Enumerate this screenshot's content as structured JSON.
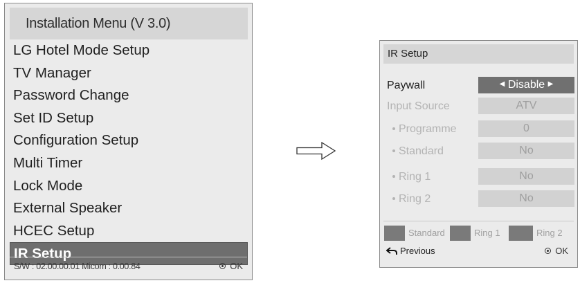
{
  "install_menu": {
    "title": "Installation Menu (V 3.0)",
    "items": [
      {
        "label": "LG Hotel Mode Setup"
      },
      {
        "label": "TV Manager"
      },
      {
        "label": "Password Change"
      },
      {
        "label": "Set ID Setup"
      },
      {
        "label": "Configuration Setup"
      },
      {
        "label": "Multi Timer"
      },
      {
        "label": "Lock Mode"
      },
      {
        "label": "External Speaker"
      },
      {
        "label": "HCEC Setup"
      },
      {
        "label": "IR Setup",
        "selected": true
      }
    ],
    "footer": {
      "version": "S/W : 02.00.00.01 Micom : 0.00.84",
      "ok_label": "OK"
    }
  },
  "ir_setup": {
    "title": "IR Setup",
    "rows": [
      {
        "label": "Paywall",
        "value": "Disable",
        "active": true
      },
      {
        "label": "Input Source",
        "value": "ATV"
      },
      {
        "label": "Programme",
        "value": "0"
      },
      {
        "label": "Standard",
        "value": "No"
      },
      {
        "label": "Ring 1",
        "value": "No"
      },
      {
        "label": "Ring 2",
        "value": "No"
      }
    ],
    "keys": [
      {
        "label": "Standard"
      },
      {
        "label": "Ring 1"
      },
      {
        "label": "Ring 2"
      }
    ],
    "previous_label": "Previous",
    "ok_label": "OK"
  },
  "colors": {
    "panel_bg": "#ebebeb",
    "selected_bg": "#6e6e6e",
    "active_value_bg": "#707070",
    "disabled_text": "#b3b3b3"
  },
  "icons": {
    "transition_arrow": "right-arrow-outline-icon",
    "ok": "ok-radio-icon",
    "previous": "back-arrow-icon",
    "value_left": "triangle-left-icon",
    "value_right": "triangle-right-icon"
  }
}
